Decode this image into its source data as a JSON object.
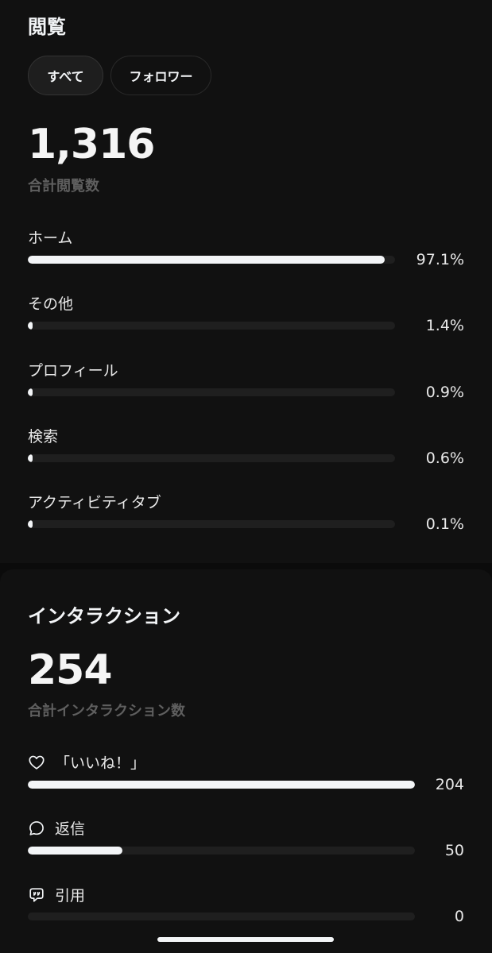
{
  "views": {
    "title": "閲覧",
    "filters": [
      {
        "label": "すべて",
        "active": true
      },
      {
        "label": "フォロワー",
        "active": false
      }
    ],
    "total": "1,316",
    "total_label": "合計閲覧数",
    "rows": [
      {
        "label": "ホーム",
        "value": "97.1%",
        "fraction": 0.971
      },
      {
        "label": "その他",
        "value": "1.4%",
        "fraction": 0.014
      },
      {
        "label": "プロフィール",
        "value": "0.9%",
        "fraction": 0.009
      },
      {
        "label": "検索",
        "value": "0.6%",
        "fraction": 0.006
      },
      {
        "label": "アクティビティタブ",
        "value": "0.1%",
        "fraction": 0.001
      }
    ]
  },
  "interactions": {
    "title": "インタラクション",
    "total": "254",
    "total_label": "合計インタラクション数",
    "rows": [
      {
        "icon": "heart-icon",
        "label": "「いいね！」",
        "value": "204",
        "fraction": 1.0
      },
      {
        "icon": "speech-bubble-icon",
        "label": "返信",
        "value": "50",
        "fraction": 0.245
      },
      {
        "icon": "quote-bubble-icon",
        "label": "引用",
        "value": "0",
        "fraction": 0.0
      }
    ]
  },
  "colors": {
    "background": "#111111",
    "bar_fill": "#f3f5f7",
    "bar_track": "#1f1f1f",
    "muted_text": "#5f5f5f"
  }
}
